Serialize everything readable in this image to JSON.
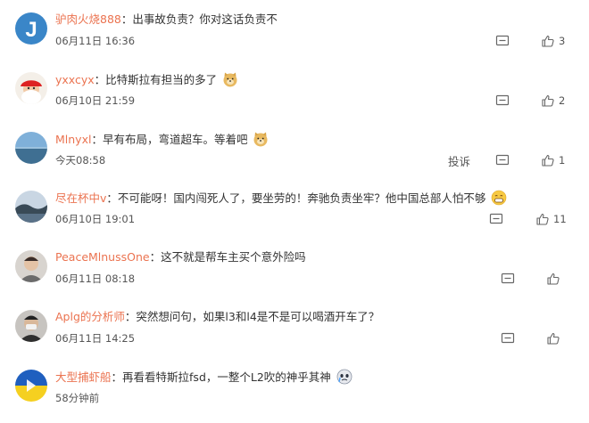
{
  "comments": [
    {
      "username": "驴肉火烧888",
      "text": "出事故负责？你对这话负责不",
      "time": "06月11日 16:36",
      "likes": "3",
      "avatar": "letter-j-avatar",
      "emoji": ""
    },
    {
      "username": "yxxcyx",
      "text": "比特斯拉有担当的多了",
      "time": "06月10日 21:59",
      "likes": "2",
      "avatar": "santa-avatar",
      "emoji": "doge-emoji"
    },
    {
      "username": "Mlnyxl",
      "text": "早有布局，弯道超车。等着吧",
      "time": "今天08:58",
      "likes": "1",
      "avatar": "sea-landscape-avatar",
      "emoji": "doge-emoji",
      "report": "投诉"
    },
    {
      "username": "尽在杯中v",
      "text": "不可能呀！国内闯死人了，要坐劳的！奔驰负责坐牢？他中国总部人怕不够",
      "time": "06月10日 19:01",
      "likes": "11",
      "avatar": "lake-landscape-avatar",
      "emoji": "grin-emoji"
    },
    {
      "username": "PeaceMlnussOne",
      "text": "这不就是帮车主买个意外险吗",
      "time": "06月11日 08:18",
      "likes": "",
      "avatar": "person-avatar",
      "emoji": ""
    },
    {
      "username": "Aplg的分析师",
      "text": "突然想问句，如果l3和l4是不是可以喝酒开车了？",
      "time": "06月11日 14:25",
      "likes": "",
      "avatar": "masked-person-avatar",
      "emoji": ""
    },
    {
      "username": "大型捕虾船",
      "text": "再看看特斯拉fsd，一整个L2吹的神乎其神",
      "time": "58分钟前",
      "likes": "",
      "avatar": "flag-avatar",
      "emoji": "cry-emoji"
    }
  ],
  "colors": {
    "username": "#eb7350",
    "text": "#333333",
    "meta": "#555555",
    "icon": "#666666"
  }
}
